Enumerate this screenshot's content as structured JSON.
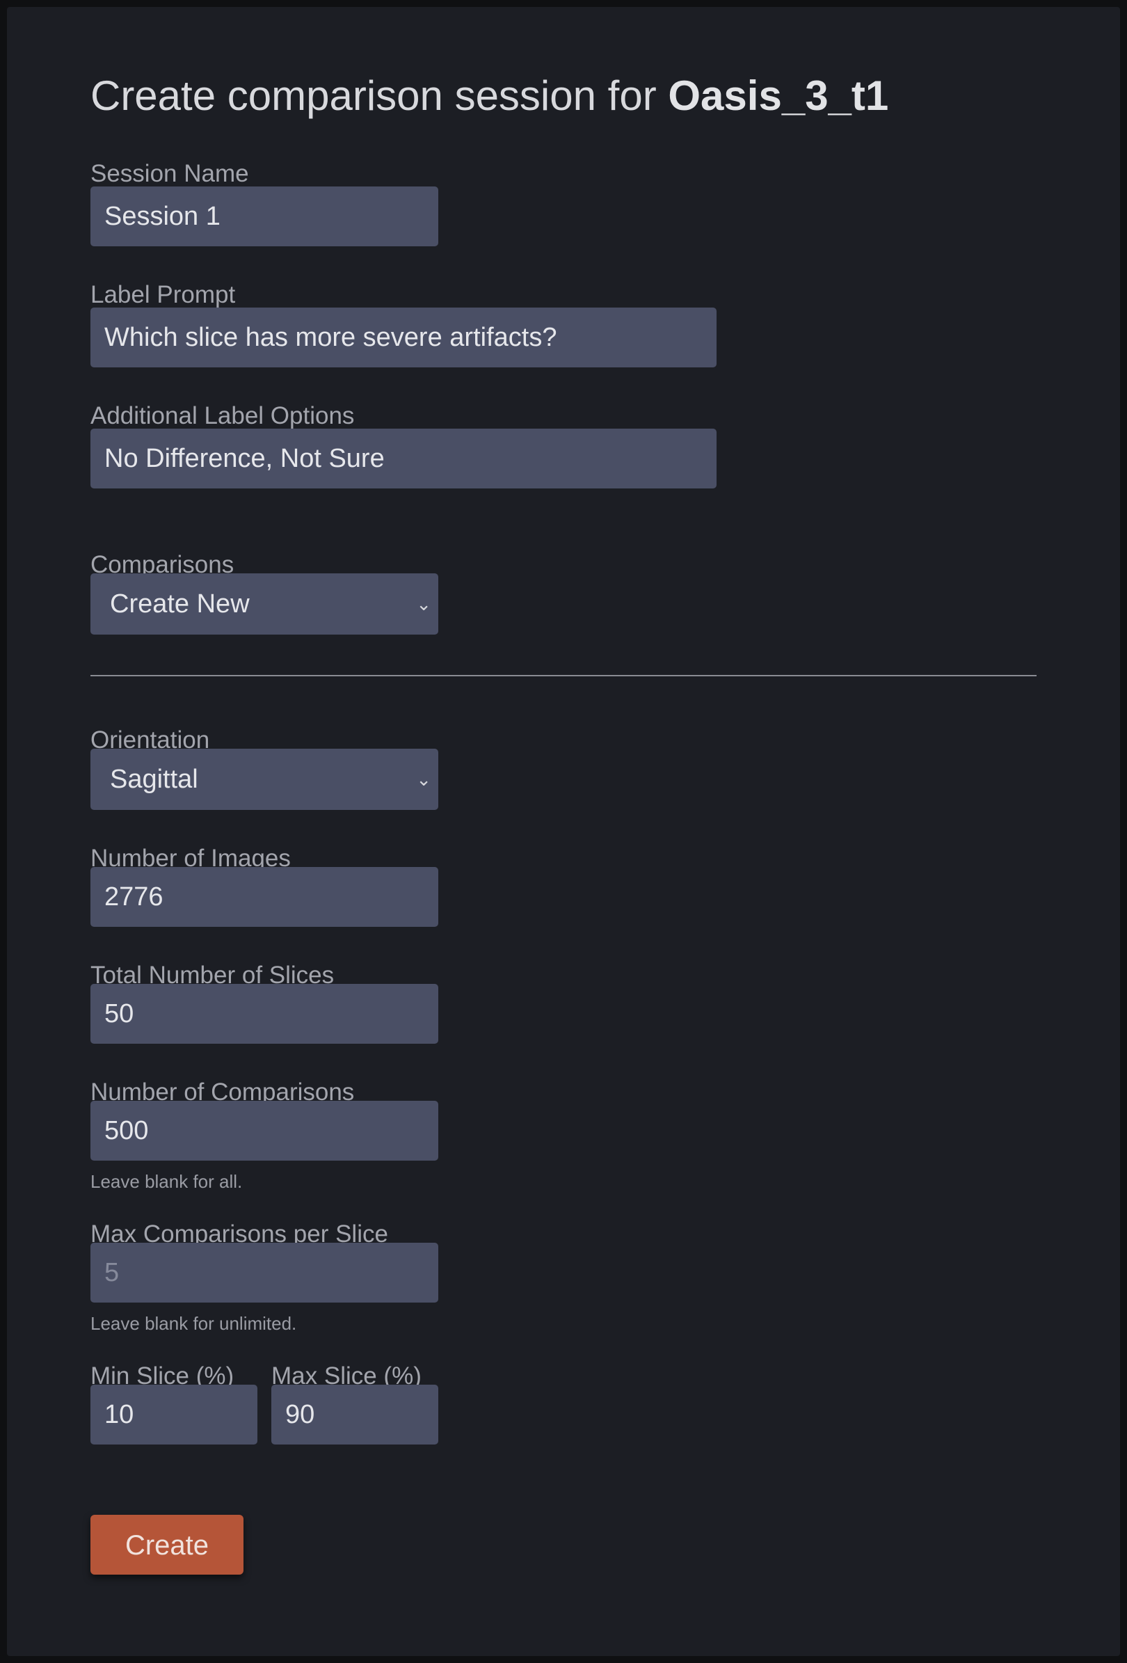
{
  "page": {
    "title_prefix": "Create comparison session for ",
    "dataset_name": "Oasis_3_t1"
  },
  "fields": {
    "session_name": {
      "label": "Session Name",
      "value": "Session 1"
    },
    "label_prompt": {
      "label": "Label Prompt",
      "value": "Which slice has more severe artifacts?"
    },
    "additional_label_options": {
      "label": "Additional Label Options",
      "value": "No Difference, Not Sure"
    },
    "comparisons": {
      "label": "Comparisons",
      "selected": "Create New"
    },
    "orientation": {
      "label": "Orientation",
      "selected": "Sagittal"
    },
    "number_of_images": {
      "label": "Number of Images",
      "value": "2776"
    },
    "total_number_of_slices": {
      "label": "Total Number of Slices",
      "value": "50"
    },
    "number_of_comparisons": {
      "label": "Number of Comparisons",
      "value": "500",
      "help": "Leave blank for all."
    },
    "max_comparisons_per_slice": {
      "label": "Max Comparisons per Slice",
      "value": "",
      "placeholder": "5",
      "help": "Leave blank for unlimited."
    },
    "min_slice": {
      "label": "Min Slice (%)",
      "value": "10"
    },
    "max_slice": {
      "label": "Max Slice (%)",
      "value": "90"
    }
  },
  "actions": {
    "create_label": "Create"
  },
  "icons": {
    "select_chevron": "chevron-down-icon"
  },
  "colors": {
    "background": "#1c1e24",
    "input_background": "#4a4f65",
    "accent": "#b55538",
    "divider": "#8a8c93"
  }
}
